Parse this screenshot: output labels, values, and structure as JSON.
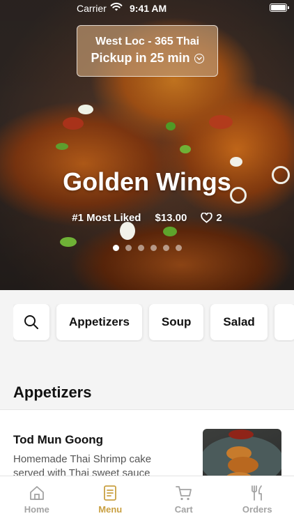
{
  "status_bar": {
    "carrier": "Carrier",
    "time": "9:41 AM"
  },
  "location": {
    "name": "West Loc - 365 Thai",
    "pickup": "Pickup in 25 min"
  },
  "hero": {
    "title": "Golden Wings",
    "rank": "#1 Most Liked",
    "price": "$13.00",
    "likes": "2",
    "carousel_total": 6,
    "carousel_active": 1
  },
  "categories": [
    "Appetizers",
    "Soup",
    "Salad"
  ],
  "section": {
    "heading": "Appetizers"
  },
  "menu_item": {
    "name": "Tod Mun Goong",
    "description": "Homemade Thai Shrimp cake served with Thai sweet sauce"
  },
  "tabs": [
    {
      "label": "Home",
      "icon": "home-icon"
    },
    {
      "label": "Menu",
      "icon": "menu-icon"
    },
    {
      "label": "Cart",
      "icon": "cart-icon"
    },
    {
      "label": "Orders",
      "icon": "fork-knife-icon"
    }
  ],
  "colors": {
    "accent": "#c9a042",
    "inactive": "#a3a3a3"
  }
}
